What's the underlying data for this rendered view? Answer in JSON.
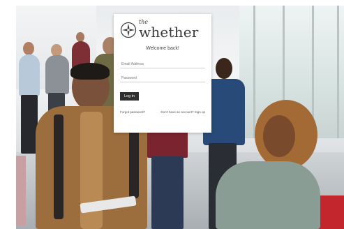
{
  "brand": {
    "prefix": "the",
    "name": "whether",
    "logo_icon": "compass-rose-icon",
    "text_color": "#3a3a3a"
  },
  "login": {
    "welcome": "Welcome back!",
    "email_placeholder": "Email Address",
    "password_placeholder": "Password",
    "submit_label": "Log in",
    "forgot_label": "Forgot password?",
    "signup_label": "Don't have an account? Sign up"
  },
  "colors": {
    "button": "#2e2e2e",
    "card": "#ffffff",
    "accent_chair": "#c4262e"
  }
}
